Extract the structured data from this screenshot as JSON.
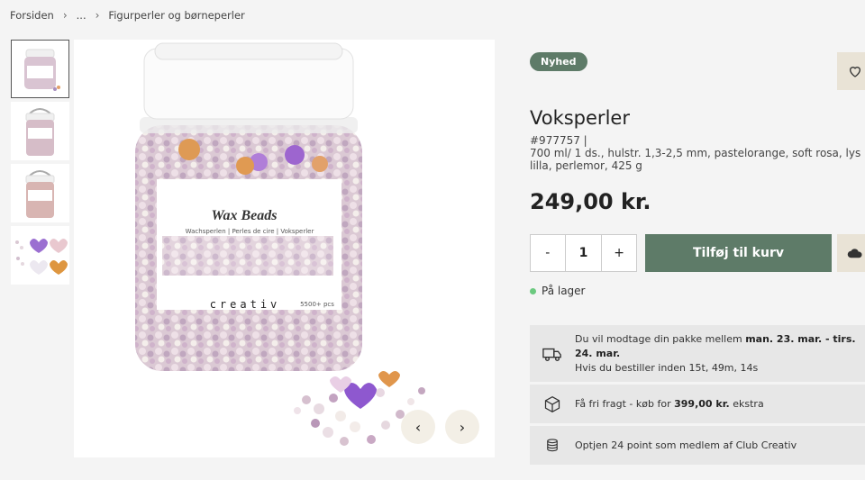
{
  "breadcrumb": {
    "home": "Forsiden",
    "ellipsis": "...",
    "current": "Figurperler og børneperler"
  },
  "product": {
    "badge": "Nyhed",
    "title": "Voksperler",
    "sku": "#977757 |",
    "description": "700 ml/ 1 ds., hulstr. 1,3-2,5 mm, pastelorange, soft rosa, lys lilla, perlemor, 425 g",
    "price": "249,00 kr.",
    "image_label": "Wax Beads",
    "image_sub": "Wachsperlen | Perles de cire | Voksperler",
    "image_brand": "creativ",
    "image_count": "5500+ pcs"
  },
  "quantity": {
    "minus": "-",
    "value": "1",
    "plus": "+"
  },
  "cart": {
    "add_label": "Tilføj til kurv"
  },
  "stock": {
    "label": "På lager",
    "color": "#6bc97f"
  },
  "delivery": {
    "line1_pre": "Du vil modtage din pakke mellem ",
    "line1_bold": "man. 23. mar. - tirs. 24. mar.",
    "line2": "Hvis du bestiller inden 15t, 49m, 14s"
  },
  "shipping": {
    "pre": "Få fri fragt - køb for ",
    "bold": "399,00 kr.",
    "post": " ekstra"
  },
  "points": {
    "text": "Optjen 24 point som medlem af  Club Creativ"
  },
  "colors": {
    "accent": "#5e7b68",
    "beige": "#e9e3d6"
  }
}
